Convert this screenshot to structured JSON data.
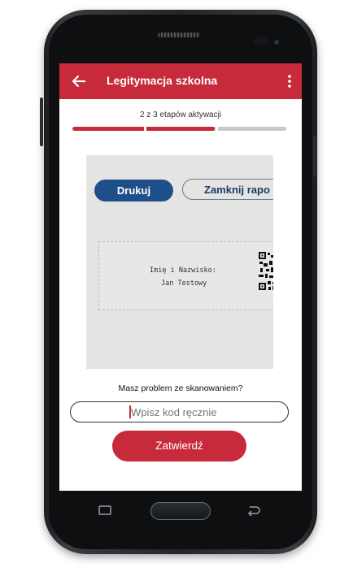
{
  "app": {
    "title": "Legitymacja szkolna",
    "accent_color": "#c72a3b",
    "back_icon": "arrow-left-icon",
    "menu_icon": "more-vert-icon"
  },
  "progress": {
    "label": "2 z 3 etapów aktywacji",
    "current_step": 2,
    "total_steps": 3,
    "fraction": 0.667
  },
  "scan_preview": {
    "print_button": "Drukuj",
    "close_button": "Zamknij rapo",
    "card_line1": "Imię i Nazwisko:",
    "card_line2": "Jan Testowy",
    "qr_icon": "qr-code-icon"
  },
  "manual_entry": {
    "question": "Masz problem ze skanowaniem?",
    "placeholder": "Wpisz kod ręcznie",
    "value": ""
  },
  "confirm_button": "Zatwierdź",
  "nav": {
    "recent_icon": "recent-apps-icon",
    "home": "home-button",
    "back_icon": "back-icon"
  }
}
